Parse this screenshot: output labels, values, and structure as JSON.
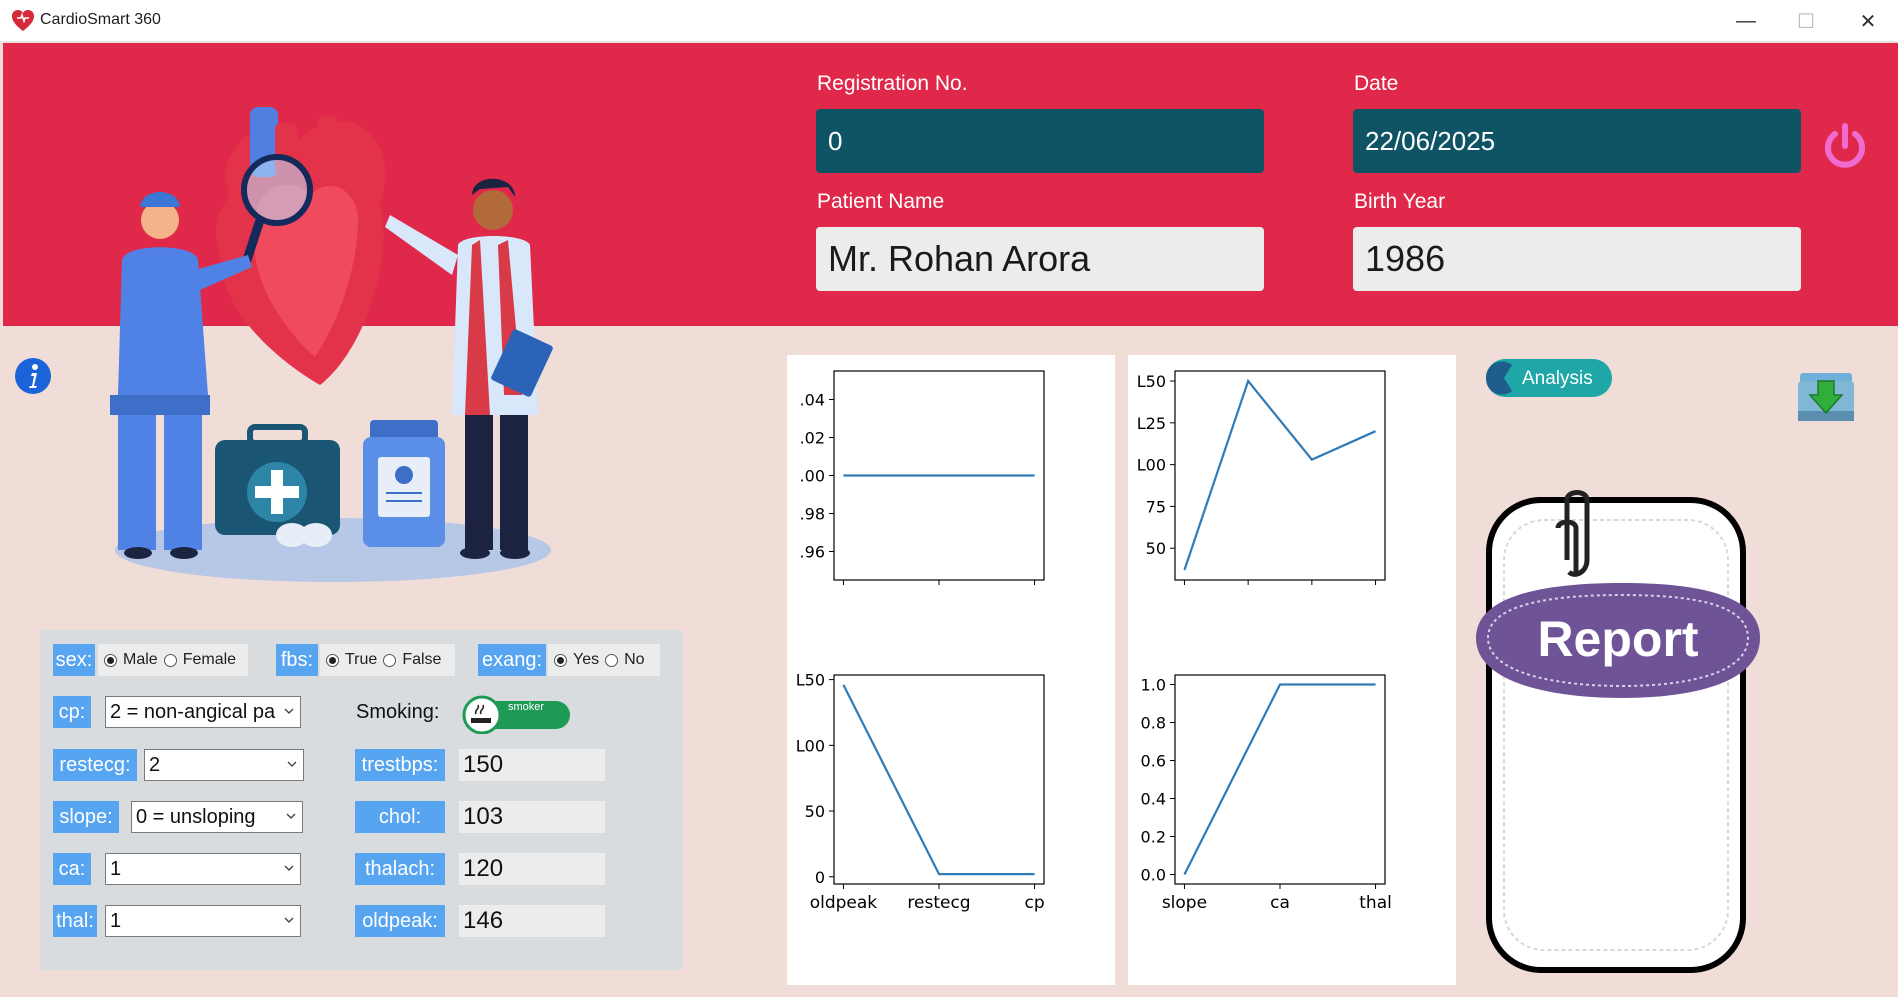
{
  "window": {
    "title": "CardioSmart 360",
    "min_glyph": "—",
    "max_glyph": "☐",
    "close_glyph": "✕"
  },
  "header": {
    "registration_label": "Registration No.",
    "registration_value": "0",
    "date_label": "Date",
    "date_value": "22/06/2025",
    "patient_label": "Patient Name",
    "patient_value": "Mr. Rohan Arora",
    "birth_label": "Birth Year",
    "birth_value": "1986"
  },
  "colors": {
    "header_bg": "#e0294a",
    "dark_field": "#0f5464",
    "tag_blue": "#57a5f0",
    "power": "#f06bd0",
    "report_purple": "#6e5396",
    "analysis_teal": "#1fa7a8"
  },
  "form": {
    "sex": {
      "label": "sex:",
      "options": [
        "Male",
        "Female"
      ],
      "selected": "Male"
    },
    "fbs": {
      "label": "fbs:",
      "options": [
        "True",
        "False"
      ],
      "selected": "True"
    },
    "exang": {
      "label": "exang:",
      "options": [
        "Yes",
        "No"
      ],
      "selected": "Yes"
    },
    "cp": {
      "label": "cp:",
      "value": "2 = non-angical pa"
    },
    "restecg": {
      "label": "restecg:",
      "value": "2"
    },
    "slope": {
      "label": "slope:",
      "value": "0 = unsloping"
    },
    "ca": {
      "label": "ca:",
      "value": "1"
    },
    "thal": {
      "label": "thal:",
      "value": "1"
    },
    "smoking": {
      "label": "Smoking:",
      "toggle_text": "smoker",
      "on": true
    },
    "trestbps": {
      "label": "trestbps:",
      "value": "150"
    },
    "chol": {
      "label": "chol:",
      "value": "103"
    },
    "thalach": {
      "label": "thalach:",
      "value": "120"
    },
    "oldpeak": {
      "label": "oldpeak:",
      "value": "146"
    }
  },
  "buttons": {
    "analysis_label": "Analysis",
    "report_label": "Report"
  },
  "icons": {
    "info": "info-icon",
    "power": "power-icon",
    "download": "download-icon",
    "smoking": "smoking-icon"
  },
  "chart_data": [
    {
      "type": "line",
      "x": [
        0,
        1,
        2
      ],
      "y": [
        1.0,
        1.0,
        1.0
      ],
      "ylim": [
        0.945,
        1.055
      ],
      "yticks": [
        0.96,
        0.98,
        1.0,
        1.02,
        1.04
      ],
      "ytick_labels": [
        ".96",
        ".98",
        ".00",
        ".02",
        ".04"
      ],
      "xticks": [
        0,
        1,
        2
      ],
      "xtick_labels": [
        "",
        "",
        ""
      ]
    },
    {
      "type": "line",
      "x": [
        0,
        1,
        2,
        3
      ],
      "y": [
        37,
        150,
        103,
        120
      ],
      "ylim": [
        31,
        156
      ],
      "yticks": [
        50,
        75,
        100,
        125,
        150
      ],
      "ytick_labels": [
        "50",
        "75",
        "L00",
        "L25",
        "L50"
      ],
      "xticks": [
        0,
        1,
        2,
        3
      ],
      "xtick_labels": [
        "",
        "",
        "",
        ""
      ]
    },
    {
      "type": "line",
      "categories": [
        "oldpeak",
        "restecg",
        "cp"
      ],
      "y": [
        146,
        2,
        2
      ],
      "ylim": [
        -5.5,
        153.5
      ],
      "yticks": [
        0,
        50,
        100,
        150
      ],
      "ytick_labels": [
        "0",
        "50",
        "L00",
        "L50"
      ],
      "xtick_labels": [
        "oldpeak",
        "restecg",
        "cp"
      ]
    },
    {
      "type": "line",
      "categories": [
        "slope",
        "ca",
        "thal"
      ],
      "y": [
        0,
        1,
        1
      ],
      "ylim": [
        -0.05,
        1.05
      ],
      "yticks": [
        0.0,
        0.2,
        0.4,
        0.6,
        0.8,
        1.0
      ],
      "ytick_labels": [
        "0.0",
        "0.2",
        "0.4",
        "0.6",
        "0.8",
        "1.0"
      ],
      "xtick_labels": [
        "slope",
        "ca",
        "thal"
      ]
    }
  ]
}
